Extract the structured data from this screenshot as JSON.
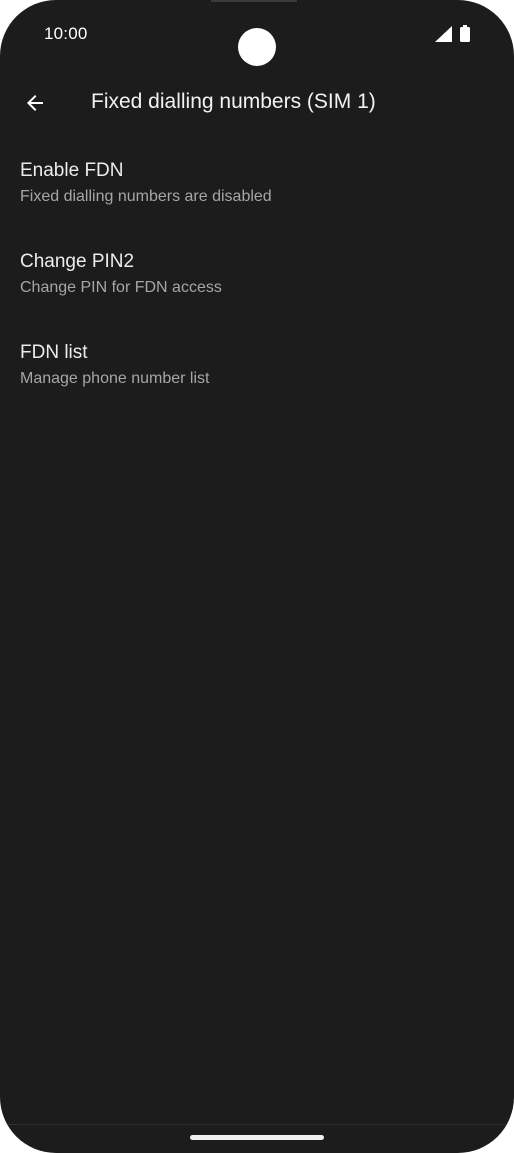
{
  "status_bar": {
    "time": "10:00",
    "signal_icon": "cellular-signal-icon",
    "battery_icon": "battery-full-icon"
  },
  "app_bar": {
    "back_icon": "arrow-back-icon",
    "title": "Fixed dialling numbers (SIM 1)"
  },
  "preferences": [
    {
      "title": "Enable FDN",
      "summary": "Fixed dialling numbers are disabled"
    },
    {
      "title": "Change PIN2",
      "summary": "Change PIN for FDN access"
    },
    {
      "title": "FDN list",
      "summary": "Manage phone number list"
    }
  ],
  "colors": {
    "background": "#1c1c1c",
    "primary_text": "#ececec",
    "secondary_text": "#a6a6a6"
  }
}
